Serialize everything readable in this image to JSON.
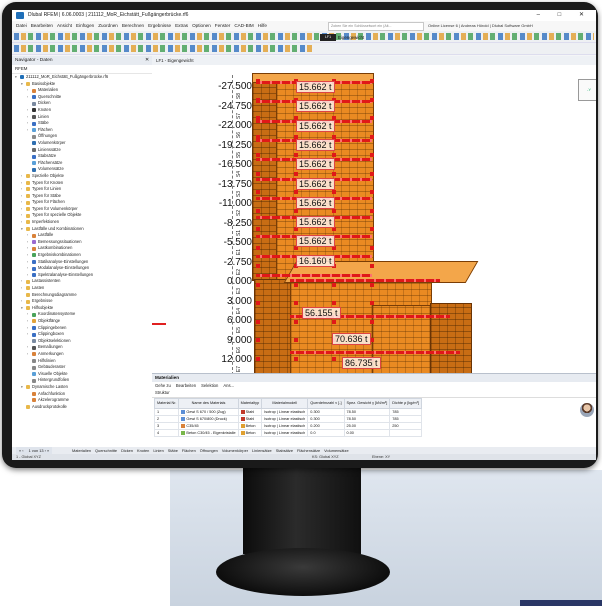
{
  "window": {
    "title": "Dlubal RFEM | 6.06.0003 | 211112_MoR_Eichstätt_Fußgängerbrücke.rf6",
    "controls": "–  □  ✕"
  },
  "menu": [
    "Datei",
    "Bearbeiten",
    "Ansicht",
    "Einfügen",
    "Zuordnen",
    "Berechnen",
    "Ergebnisse",
    "Extras",
    "Optionen",
    "Fenster",
    "CAD-BIM",
    "Hilfe"
  ],
  "search_placeholder": "Zoben Sie ein Schlüsselwort ein (Alt...",
  "license": "Online License 6 | Andreas Hörold | Dlubal Software GmbH",
  "loadcase": {
    "code": "LF1",
    "name": "Eigengewicht"
  },
  "navigator": {
    "title": "Navigator - Daten",
    "subtitle": "RFEM",
    "items": [
      {
        "label": "211112_MoR_Eichstätt_Fußgängerbrücke.rf6",
        "level": 0,
        "arrow": "▾",
        "color": "#1f6fb8"
      },
      {
        "label": "Basisobjekte",
        "level": 1,
        "arrow": "▾",
        "color": "#e8b84a"
      },
      {
        "label": "Materialien",
        "level": 2,
        "arrow": "›",
        "color": "#d9823a"
      },
      {
        "label": "Querschnitte",
        "level": 2,
        "arrow": "›",
        "color": "#3a6fc4"
      },
      {
        "label": "Dicken",
        "level": 2,
        "arrow": "",
        "color": "#7a8aa0"
      },
      {
        "label": "Knoten",
        "level": 2,
        "arrow": "›",
        "color": "#333333"
      },
      {
        "label": "Linien",
        "level": 2,
        "arrow": "›",
        "color": "#555555"
      },
      {
        "label": "Stäbe",
        "level": 2,
        "arrow": "›",
        "color": "#3a6fc4"
      },
      {
        "label": "Flächen",
        "level": 2,
        "arrow": "›",
        "color": "#5aa0d8"
      },
      {
        "label": "Öffnungen",
        "level": 2,
        "arrow": "",
        "color": "#8a8a8a"
      },
      {
        "label": "Volumenkörper",
        "level": 2,
        "arrow": "",
        "color": "#2f6fb0"
      },
      {
        "label": "Linienssätze",
        "level": 2,
        "arrow": "",
        "color": "#6a6a6a"
      },
      {
        "label": "Stabsätze",
        "level": 2,
        "arrow": "",
        "color": "#3a6fc4"
      },
      {
        "label": "Flächensätze",
        "level": 2,
        "arrow": "",
        "color": "#5aa0d8"
      },
      {
        "label": "Volumensätze",
        "level": 2,
        "arrow": "",
        "color": "#2f6fb0"
      },
      {
        "label": "Spezielle Objekte",
        "level": 1,
        "arrow": "›",
        "color": "#e8b84a"
      },
      {
        "label": "Typen für Knoten",
        "level": 1,
        "arrow": "›",
        "color": "#e8b84a"
      },
      {
        "label": "Typen für Linien",
        "level": 1,
        "arrow": "›",
        "color": "#e8b84a"
      },
      {
        "label": "Typen für Stäbe",
        "level": 1,
        "arrow": "›",
        "color": "#e8b84a"
      },
      {
        "label": "Typen für Flächen",
        "level": 1,
        "arrow": "›",
        "color": "#e8b84a"
      },
      {
        "label": "Typen für Volumenkörper",
        "level": 1,
        "arrow": "›",
        "color": "#e8b84a"
      },
      {
        "label": "Typen für spezielle Objekte",
        "level": 1,
        "arrow": "›",
        "color": "#e8b84a"
      },
      {
        "label": "Imperfektionen",
        "level": 1,
        "arrow": "›",
        "color": "#e8b84a"
      },
      {
        "label": "Lastfälle und Kombinationen",
        "level": 1,
        "arrow": "▾",
        "color": "#e8b84a"
      },
      {
        "label": "Lastfälle",
        "level": 2,
        "arrow": "›",
        "color": "#d9823a"
      },
      {
        "label": "Bemessungssituationen",
        "level": 2,
        "arrow": "›",
        "color": "#9a6ad0"
      },
      {
        "label": "Lastkombinationen",
        "level": 2,
        "arrow": "›",
        "color": "#d9823a"
      },
      {
        "label": "Ergebniskombinationen",
        "level": 2,
        "arrow": "›",
        "color": "#4aa35b"
      },
      {
        "label": "Statikanalyse-Einstellungen",
        "level": 2,
        "arrow": "›",
        "color": "#3a6fc4"
      },
      {
        "label": "Modalanalyse-Einstellungen",
        "level": 2,
        "arrow": "›",
        "color": "#3a6fc4"
      },
      {
        "label": "Spektralanalyse-Einstellungen",
        "level": 2,
        "arrow": "›",
        "color": "#3a6fc4"
      },
      {
        "label": "Lastassistenten",
        "level": 1,
        "arrow": "›",
        "color": "#e8b84a"
      },
      {
        "label": "Lasten",
        "level": 1,
        "arrow": "›",
        "color": "#e8b84a"
      },
      {
        "label": "Berechnungsdiagramme",
        "level": 1,
        "arrow": "",
        "color": "#e8b84a"
      },
      {
        "label": "Ergebnisse",
        "level": 1,
        "arrow": "›",
        "color": "#e8b84a"
      },
      {
        "label": "Hilfsobjekte",
        "level": 1,
        "arrow": "▾",
        "color": "#e8b84a"
      },
      {
        "label": "Koordinatensysteme",
        "level": 2,
        "arrow": "›",
        "color": "#4aa35b"
      },
      {
        "label": "Objektfänge",
        "level": 2,
        "arrow": "›",
        "color": "#e2a33a"
      },
      {
        "label": "Clippingebenen",
        "level": 2,
        "arrow": "›",
        "color": "#3a6fc4"
      },
      {
        "label": "Clippingboxen",
        "level": 2,
        "arrow": "›",
        "color": "#3a6fc4"
      },
      {
        "label": "Objektselektionen",
        "level": 2,
        "arrow": "",
        "color": "#7a8aa0"
      },
      {
        "label": "Bemaßungen",
        "level": 2,
        "arrow": "›",
        "color": "#555555"
      },
      {
        "label": "Anmerkungen",
        "level": 2,
        "arrow": "›",
        "color": "#d9823a"
      },
      {
        "label": "Hilfslinien",
        "level": 2,
        "arrow": "",
        "color": "#888888"
      },
      {
        "label": "Gebäuderaster",
        "level": 2,
        "arrow": "",
        "color": "#888888"
      },
      {
        "label": "Visuelle Objekte",
        "level": 2,
        "arrow": "",
        "color": "#5aa0d8"
      },
      {
        "label": "Hintergrundfolien",
        "level": 2,
        "arrow": "",
        "color": "#888888"
      },
      {
        "label": "Dynamische Lasten",
        "level": 1,
        "arrow": "▾",
        "color": "#e8b84a"
      },
      {
        "label": "Anfachfunktion",
        "level": 2,
        "arrow": "",
        "color": "#d9823a"
      },
      {
        "label": "Akzelerogramme",
        "level": 2,
        "arrow": "",
        "color": "#d9823a"
      },
      {
        "label": "Ausdruckprotokolle",
        "level": 1,
        "arrow": "",
        "color": "#e8b84a"
      }
    ]
  },
  "viewport": {
    "tab": "LF1 - Eigengewicht",
    "view_cube_label": "-Y",
    "levels": [
      "-27.500",
      "-24.750",
      "-22.000",
      "-19.250",
      "-16.500",
      "-13.750",
      "-11.000",
      "-8.250",
      "-5.500",
      "-2.750",
      "0.000",
      "3.000",
      "6.000",
      "9.000",
      "12.000"
    ],
    "level_tags": [
      "S8",
      "S7",
      "S6",
      "S5",
      "S4",
      "S3",
      "S2",
      "S1",
      "E1",
      "E2",
      "E3",
      "E4",
      "E5",
      "E6",
      "E7"
    ],
    "loads": [
      "15.662 t",
      "15.662 t",
      "15.662 t",
      "15.662 t",
      "15.662 t",
      "15.662 t",
      "15.662 t",
      "15.662 t",
      "15.662 t",
      "16.160 t",
      "56.155 t",
      "70.636 t",
      "86.735 t"
    ]
  },
  "materials_panel": {
    "title": "Materialien",
    "menu": [
      "Gehe zu",
      "Bearbeiten",
      "Selektion",
      "Ans..."
    ],
    "structure": "Struktur",
    "columns": [
      "Material Nr.",
      "Name des Materials",
      "Materialtyp",
      "Materialmodell",
      "Querdehnzahl ν [-]",
      "Spez. Gewicht γ [kN/m³]",
      "Dichte ρ [kg/m³]"
    ],
    "rows": [
      {
        "no": "1",
        "name": "Gewi S 670 / 500 (Zug)",
        "color": "#5b8ed6",
        "type": "Stahl",
        "tcolor": "#c0392b",
        "model": "Isotrop | Linear elastisch",
        "nu": "0.300",
        "gamma": "78.50",
        "rho": "785"
      },
      {
        "no": "2",
        "name": "Gewi S 670/800 (Druck)",
        "color": "#5b8ed6",
        "type": "Stahl",
        "tcolor": "#c0392b",
        "model": "Isotrop | Linear elastisch",
        "nu": "0.300",
        "gamma": "78.50",
        "rho": "785"
      },
      {
        "no": "3",
        "name": "C35/45",
        "color": "#d9823a",
        "type": "Beton",
        "tcolor": "#e0a030",
        "model": "Isotrop | Linear elastisch",
        "nu": "0.200",
        "gamma": "25.00",
        "rho": "250"
      },
      {
        "no": "4",
        "name": "Beton C30/45 - Eigenkristalle",
        "color": "#78b64a",
        "type": "Beton",
        "tcolor": "#e0a030",
        "model": "Isotrop | Linear elastisch",
        "nu": "0.0",
        "gamma": "0.00",
        "rho": ""
      }
    ]
  },
  "bottom_tabs": [
    "Materialien",
    "Querschnitte",
    "Dicken",
    "Knoten",
    "Linien",
    "Stäbe",
    "Flächen",
    "Öffnungen",
    "Volumenkörper",
    "Liniensätze",
    "Stabsätze",
    "Flächensätze",
    "Volumensätze"
  ],
  "pager": "1 von 13",
  "status": {
    "left": "1 - Global XYZ",
    "center": "KS: Global XYZ",
    "right": "Ebene: XY"
  }
}
